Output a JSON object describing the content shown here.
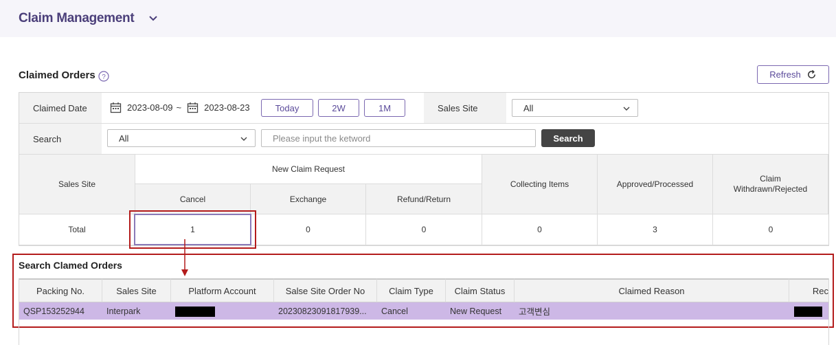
{
  "header": {
    "title": "Claim Management",
    "chevron_icon": "chevron-down-icon"
  },
  "section": {
    "title": "Claimed Orders",
    "help_icon": "help-circle-icon",
    "refresh_label": "Refresh",
    "refresh_icon": "refresh-icon"
  },
  "filters": {
    "claimed_date_label": "Claimed Date",
    "date_from": "2023-08-09",
    "date_sep": "~",
    "date_to": "2023-08-23",
    "quick_ranges": [
      "Today",
      "2W",
      "1M"
    ],
    "sales_site_label": "Sales Site",
    "sales_site_value": "All",
    "search_label": "Search",
    "search_type_value": "All",
    "search_placeholder": "Please input the ketword",
    "search_button": "Search"
  },
  "summary": {
    "col_sales_site": "Sales Site",
    "group_new_claim": "New Claim Request",
    "col_cancel": "Cancel",
    "col_exchange": "Exchange",
    "col_refund": "Refund/Return",
    "col_collecting": "Collecting Items",
    "col_approved": "Approved/Processed",
    "col_withdrawn": "Claim Withdrawn/Rejected",
    "row_label": "Total",
    "values": [
      "1",
      "0",
      "0",
      "0",
      "3",
      "0"
    ]
  },
  "results": {
    "title": "Search Clamed Orders",
    "columns": [
      "Packing No.",
      "Sales Site",
      "Platform Account",
      "Salse Site Order No",
      "Claim Type",
      "Claim Status",
      "Claimed Reason",
      "Rec"
    ],
    "rows": [
      {
        "packing_no": "QSP153252944",
        "sales_site": "Interpark",
        "platform_account": "",
        "order_no": "20230823091817939...",
        "claim_type": "Cancel",
        "claim_status": "New Request",
        "claimed_reason": "고객변심",
        "rec": ""
      }
    ]
  },
  "colors": {
    "accent": "#5a4a9a",
    "selected_row": "#cdb8e6",
    "annotation": "#b31b1b"
  }
}
